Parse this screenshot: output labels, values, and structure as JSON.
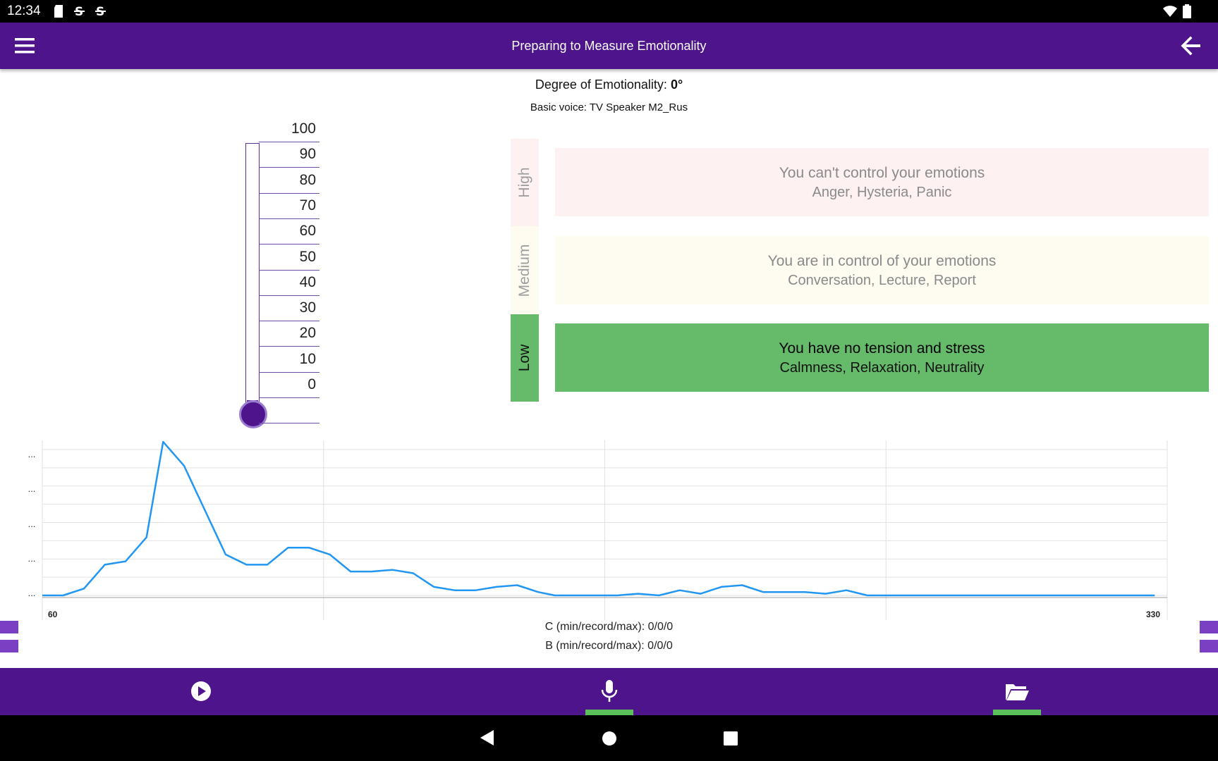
{
  "status_bar": {
    "time": "12:34",
    "icons": [
      "sd-card-icon",
      "s-app-icon",
      "s-app-icon",
      "wifi-icon",
      "battery-icon"
    ]
  },
  "app_bar": {
    "title": "Preparing to Measure Emotionality",
    "menu_icon": "hamburger-menu-icon",
    "back_icon": "arrow-back-icon"
  },
  "degree": {
    "label": "Degree of Emotionality:",
    "value": "0°"
  },
  "basic_voice": "Basic voice: TV Speaker M2_Rus",
  "thermometer": {
    "ticks": [
      "100",
      "90",
      "80",
      "70",
      "60",
      "50",
      "40",
      "30",
      "20",
      "10",
      "0"
    ],
    "level": 0
  },
  "levels": [
    {
      "tab": "High",
      "title": "You can't control your emotions",
      "subtitle": "Anger, Hysteria, Panic",
      "tab_color": "#fdf1f2",
      "card_color": "#fdf1f2",
      "active": false
    },
    {
      "tab": "Medium",
      "title": "You are in control of your emotions",
      "subtitle": "Conversation, Lecture, Report",
      "tab_color": "#fefbf0",
      "card_color": "#fefbf0",
      "active": false
    },
    {
      "tab": "Low",
      "title": "You have no tension and stress",
      "subtitle": "Calmness, Relaxation, Neutrality",
      "tab_color": "#66bb6a",
      "card_color": "#66bb6a",
      "active": true
    }
  ],
  "chart_data": {
    "type": "line",
    "title": "",
    "xlabel": "",
    "ylabel": "",
    "x_tick_labels": [
      "60",
      "330"
    ],
    "y_tick_labels": [
      "...",
      "...",
      "...",
      "...",
      "..."
    ],
    "xlim": [
      60,
      330
    ],
    "ylim": [
      0,
      45
    ],
    "grid": true,
    "color": "#2196f3",
    "series": [
      {
        "x": [
          60,
          65,
          70,
          75,
          80,
          85,
          89,
          94,
          99,
          104,
          109,
          114,
          119,
          124,
          129,
          134,
          139,
          144,
          149,
          154,
          159,
          164,
          169,
          174,
          179,
          183,
          188,
          193,
          198,
          203,
          208,
          213,
          218,
          223,
          228,
          233,
          238,
          243,
          248,
          253,
          258,
          263,
          268,
          273,
          278,
          283,
          288,
          293,
          298,
          303,
          308,
          313,
          318,
          323,
          327
        ],
        "y": [
          0,
          0,
          2,
          9,
          10,
          17,
          45,
          38,
          25,
          12,
          9,
          9,
          14,
          14,
          12,
          7,
          7,
          7.5,
          6.5,
          2.5,
          1.5,
          1.5,
          2.5,
          3,
          1,
          0,
          0,
          0,
          0,
          0.5,
          0,
          1.5,
          0.5,
          2.5,
          3,
          1,
          1,
          1,
          0.5,
          1.5,
          0,
          0,
          0,
          0,
          0,
          0,
          0,
          0,
          0,
          0,
          0,
          0,
          0,
          0,
          0
        ]
      }
    ]
  },
  "stats": {
    "c": "C (min/record/max): 0/0/0",
    "b": "B (min/record/max): 0/0/0"
  },
  "bottom_bar": {
    "play_icon": "play-circle-icon",
    "mic_icon": "microphone-icon",
    "folder_icon": "folder-open-icon"
  },
  "nav_bar": {
    "back_icon": "nav-back-icon",
    "home_icon": "nav-home-icon",
    "recents_icon": "nav-recents-icon"
  },
  "colors": {
    "primary": "#4e148c",
    "accent_green": "#66bb6a",
    "indicator_green": "#5bc05b",
    "chart_line": "#2196f3"
  }
}
